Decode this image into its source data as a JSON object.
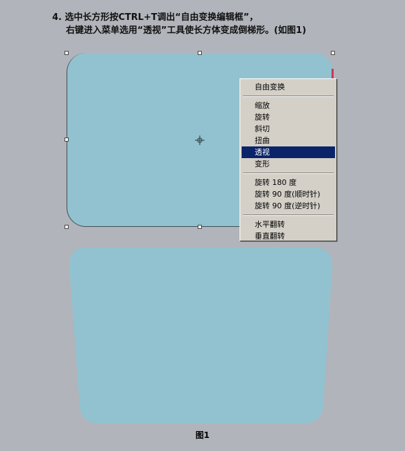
{
  "instructions": {
    "line1": "4. 选中长方形按CTRL+T调出“自由变换编辑框”，",
    "line2": "右键进入菜单选用“透视”工具使长方体变成倒梯形。(如图1)"
  },
  "context_menu": {
    "group1": [
      "自由变换"
    ],
    "group2": [
      "缩放",
      "旋转",
      "斜切",
      "扭曲",
      "透视",
      "变形"
    ],
    "group3": [
      "旋转 180 度",
      "旋转 90 度(顺时针)",
      "旋转 90 度(逆时针)"
    ],
    "group4": [
      "水平翻转",
      "垂直翻转"
    ],
    "highlighted_item": "透视"
  },
  "figure_caption": "图1",
  "colors": {
    "background": "#b1b4ba",
    "shape_fill": "#92c2cf",
    "menu_bg": "#d4d0c8",
    "menu_highlight": "#0a246a"
  },
  "icons": [
    "transform-pivot-icon"
  ]
}
